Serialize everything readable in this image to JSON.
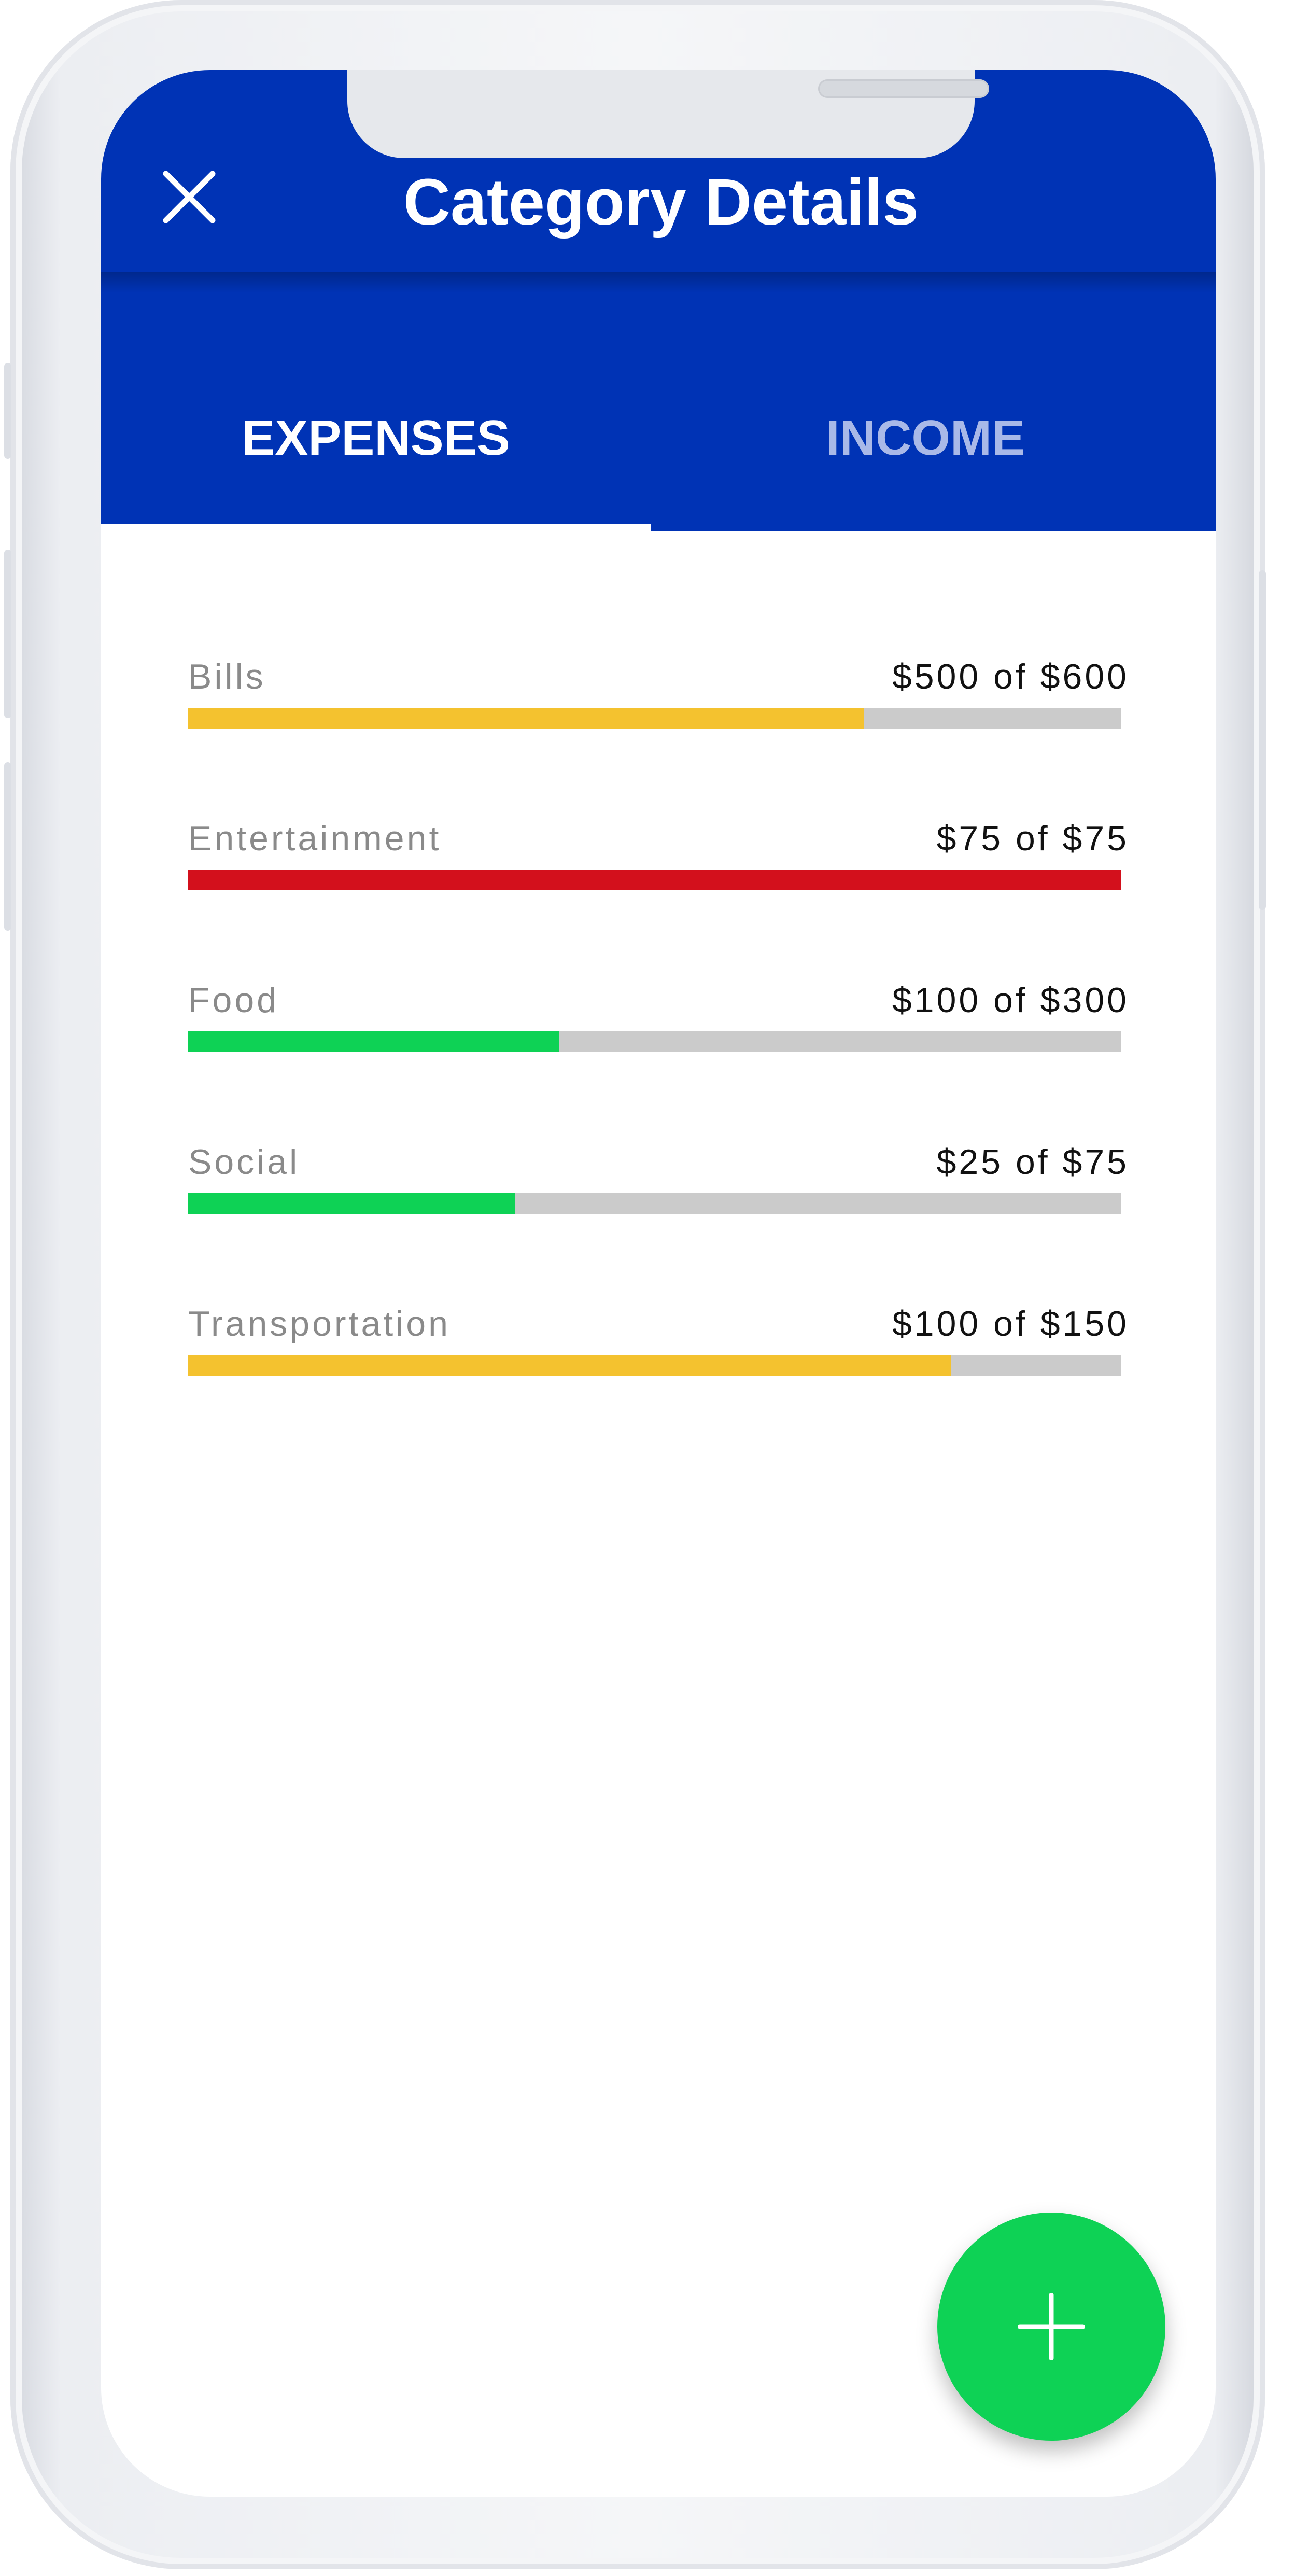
{
  "header": {
    "title": "Category Details"
  },
  "tabs": [
    {
      "label": "EXPENSES",
      "active": true
    },
    {
      "label": "INCOME",
      "active": false
    }
  ],
  "categories": [
    {
      "name": "Bills",
      "amount": "$500 of $600",
      "spent": 500,
      "budget": 600,
      "progress": 0.724,
      "color": "#f4c22f"
    },
    {
      "name": "Entertainment",
      "amount": "$75 of $75",
      "spent": 75,
      "budget": 75,
      "progress": 1.0,
      "color": "#d3101c"
    },
    {
      "name": "Food",
      "amount": "$100 of $300",
      "spent": 100,
      "budget": 300,
      "progress": 0.398,
      "color": "#0ed255"
    },
    {
      "name": "Social",
      "amount": "$25 of $75",
      "spent": 25,
      "budget": 75,
      "progress": 0.35,
      "color": "#0ed255"
    },
    {
      "name": "Transportation",
      "amount": "$100 of $150",
      "spent": 100,
      "budget": 150,
      "progress": 0.817,
      "color": "#f4c22f"
    }
  ],
  "colors": {
    "brand": "#0033b5",
    "tab_inactive": "#a9b9e8",
    "track": "#cbcbcb",
    "fab": "#0ed255"
  },
  "icons": {
    "close": "close-icon",
    "add": "plus-icon"
  }
}
